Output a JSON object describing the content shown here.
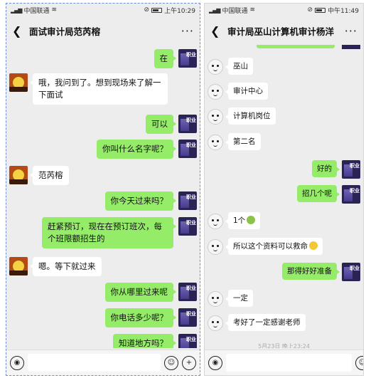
{
  "left": {
    "status": {
      "carrier": "中国联通",
      "time": "上午10:29"
    },
    "title": "面试审计局范芮榕",
    "messages": [
      {
        "side": "self",
        "text": "在"
      },
      {
        "side": "other",
        "text": "哦，我问到了。想到现场来了解一下面试"
      },
      {
        "side": "self",
        "text": "可以"
      },
      {
        "side": "self",
        "text": "你叫什么名字呢？"
      },
      {
        "side": "other",
        "text": "范芮榕"
      },
      {
        "side": "self",
        "text": "你今天过来吗？"
      },
      {
        "side": "self",
        "text": "赶紧预订，现在在预订班次，每个班限额招生的"
      },
      {
        "side": "other",
        "text": "嗯。等下就过来"
      },
      {
        "side": "self",
        "text": "你从哪里过来呢"
      },
      {
        "side": "self",
        "text": "你电话多少呢？"
      },
      {
        "side": "self",
        "text": "知道地方吗？"
      }
    ]
  },
  "right": {
    "status": {
      "carrier": "中国联通",
      "time": "中午11:49"
    },
    "title": "审计局巫山计算机审计杨洋",
    "messages": [
      {
        "side": "other",
        "text": "巫山"
      },
      {
        "side": "other",
        "text": "审计中心"
      },
      {
        "side": "other",
        "text": "计算机岗位"
      },
      {
        "side": "other",
        "text": "第二名"
      },
      {
        "side": "self",
        "text": "好的"
      },
      {
        "side": "self",
        "text": "招几个呢"
      },
      {
        "side": "other",
        "text": "1个"
      },
      {
        "side": "other",
        "text": "所以这个资料可以救命"
      },
      {
        "side": "self",
        "text": "那得好好准备"
      },
      {
        "side": "other",
        "text": "一定"
      },
      {
        "side": "other",
        "text": "考好了一定感谢老师"
      }
    ],
    "timestamp": "5月23日 晚上23:24"
  },
  "icons": {
    "back": "chevron-left-icon",
    "more": "more-dots-icon",
    "voice": "voice-icon",
    "emoji": "emoji-icon",
    "plus": "plus-icon"
  },
  "colors": {
    "self_bubble": "#95ec69",
    "other_bubble": "#ffffff",
    "background": "#ededed"
  }
}
